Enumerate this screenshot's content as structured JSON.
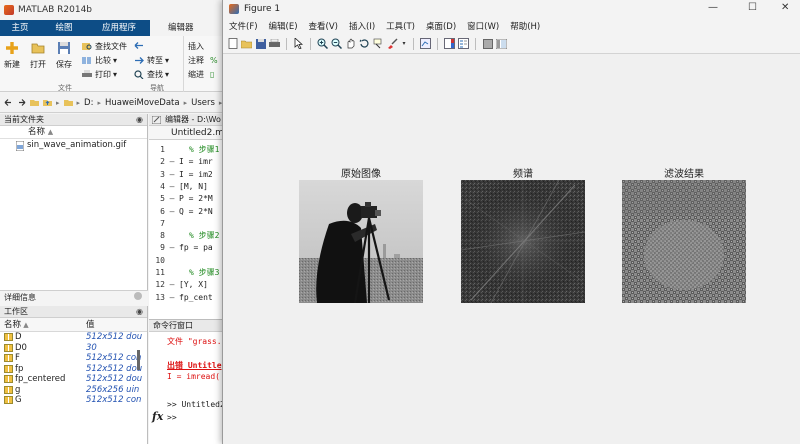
{
  "matlab": {
    "title": "MATLAB R2014b",
    "tabs": [
      "主页",
      "绘图",
      "应用程序",
      "编辑器"
    ],
    "ribbon": {
      "new": "新建",
      "open": "打开",
      "save": "保存",
      "find_files": "查找文件",
      "compare": "比较",
      "print": "打印",
      "goto": "转至",
      "find": "查找",
      "insert": "插入",
      "comment": "注释",
      "indent": "缩进",
      "group_file": "文件",
      "group_nav": "导航"
    },
    "address": [
      "D:",
      "HuaweiMoveData",
      "Users"
    ],
    "current_folder": {
      "title": "当前文件夹",
      "col_name": "名称",
      "files": [
        "sin_wave_animation.gif"
      ]
    },
    "details_title": "详细信息",
    "workspace": {
      "title": "工作区",
      "col_name": "名称",
      "col_value": "值",
      "vars": [
        {
          "name": "D",
          "value": "512x512 dou"
        },
        {
          "name": "D0",
          "value": "30"
        },
        {
          "name": "F",
          "value": "512x512 con"
        },
        {
          "name": "fp",
          "value": "512x512 dou"
        },
        {
          "name": "fp_centered",
          "value": "512x512 dou"
        },
        {
          "name": "g",
          "value": "256x256 uin"
        },
        {
          "name": "G",
          "value": "512x512 con"
        }
      ]
    },
    "editor": {
      "header": "编辑器 - D:\\Wo",
      "tab": "Untitled2.m",
      "lines": [
        {
          "n": "1",
          "dash": "",
          "text": "% 步骤1",
          "comment": true
        },
        {
          "n": "2",
          "dash": "–",
          "text": "I = imr",
          "comment": false
        },
        {
          "n": "3",
          "dash": "–",
          "text": "I = im2",
          "comment": false
        },
        {
          "n": "4",
          "dash": "–",
          "text": "[M, N]",
          "comment": false
        },
        {
          "n": "5",
          "dash": "–",
          "text": "P = 2*M",
          "comment": false
        },
        {
          "n": "6",
          "dash": "–",
          "text": "Q = 2*N",
          "comment": false
        },
        {
          "n": "7",
          "dash": "",
          "text": "",
          "comment": false
        },
        {
          "n": "8",
          "dash": "",
          "text": "% 步骤2",
          "comment": true
        },
        {
          "n": "9",
          "dash": "–",
          "text": "fp = pa",
          "comment": false
        },
        {
          "n": "10",
          "dash": "",
          "text": "",
          "comment": false
        },
        {
          "n": "11",
          "dash": "",
          "text": "% 步骤3",
          "comment": true
        },
        {
          "n": "12",
          "dash": "–",
          "text": "[Y, X]",
          "comment": false
        },
        {
          "n": "13",
          "dash": "–",
          "text": "fp_cent",
          "comment": false
        }
      ]
    },
    "command": {
      "title": "命令行窗口",
      "l1": "文件 \"grass.",
      "l2": "出错 Untitle",
      "l3": "I = imread('",
      "l4": ">> Untitled2",
      "prompt": ">>",
      "fx": "fx"
    }
  },
  "figure": {
    "title": "Figure 1",
    "menu": [
      "文件(F)",
      "编辑(E)",
      "查看(V)",
      "插入(I)",
      "工具(T)",
      "桌面(D)",
      "窗口(W)",
      "帮助(H)"
    ],
    "subplots": [
      "原始图像",
      "频谱",
      "滤波结果"
    ]
  }
}
